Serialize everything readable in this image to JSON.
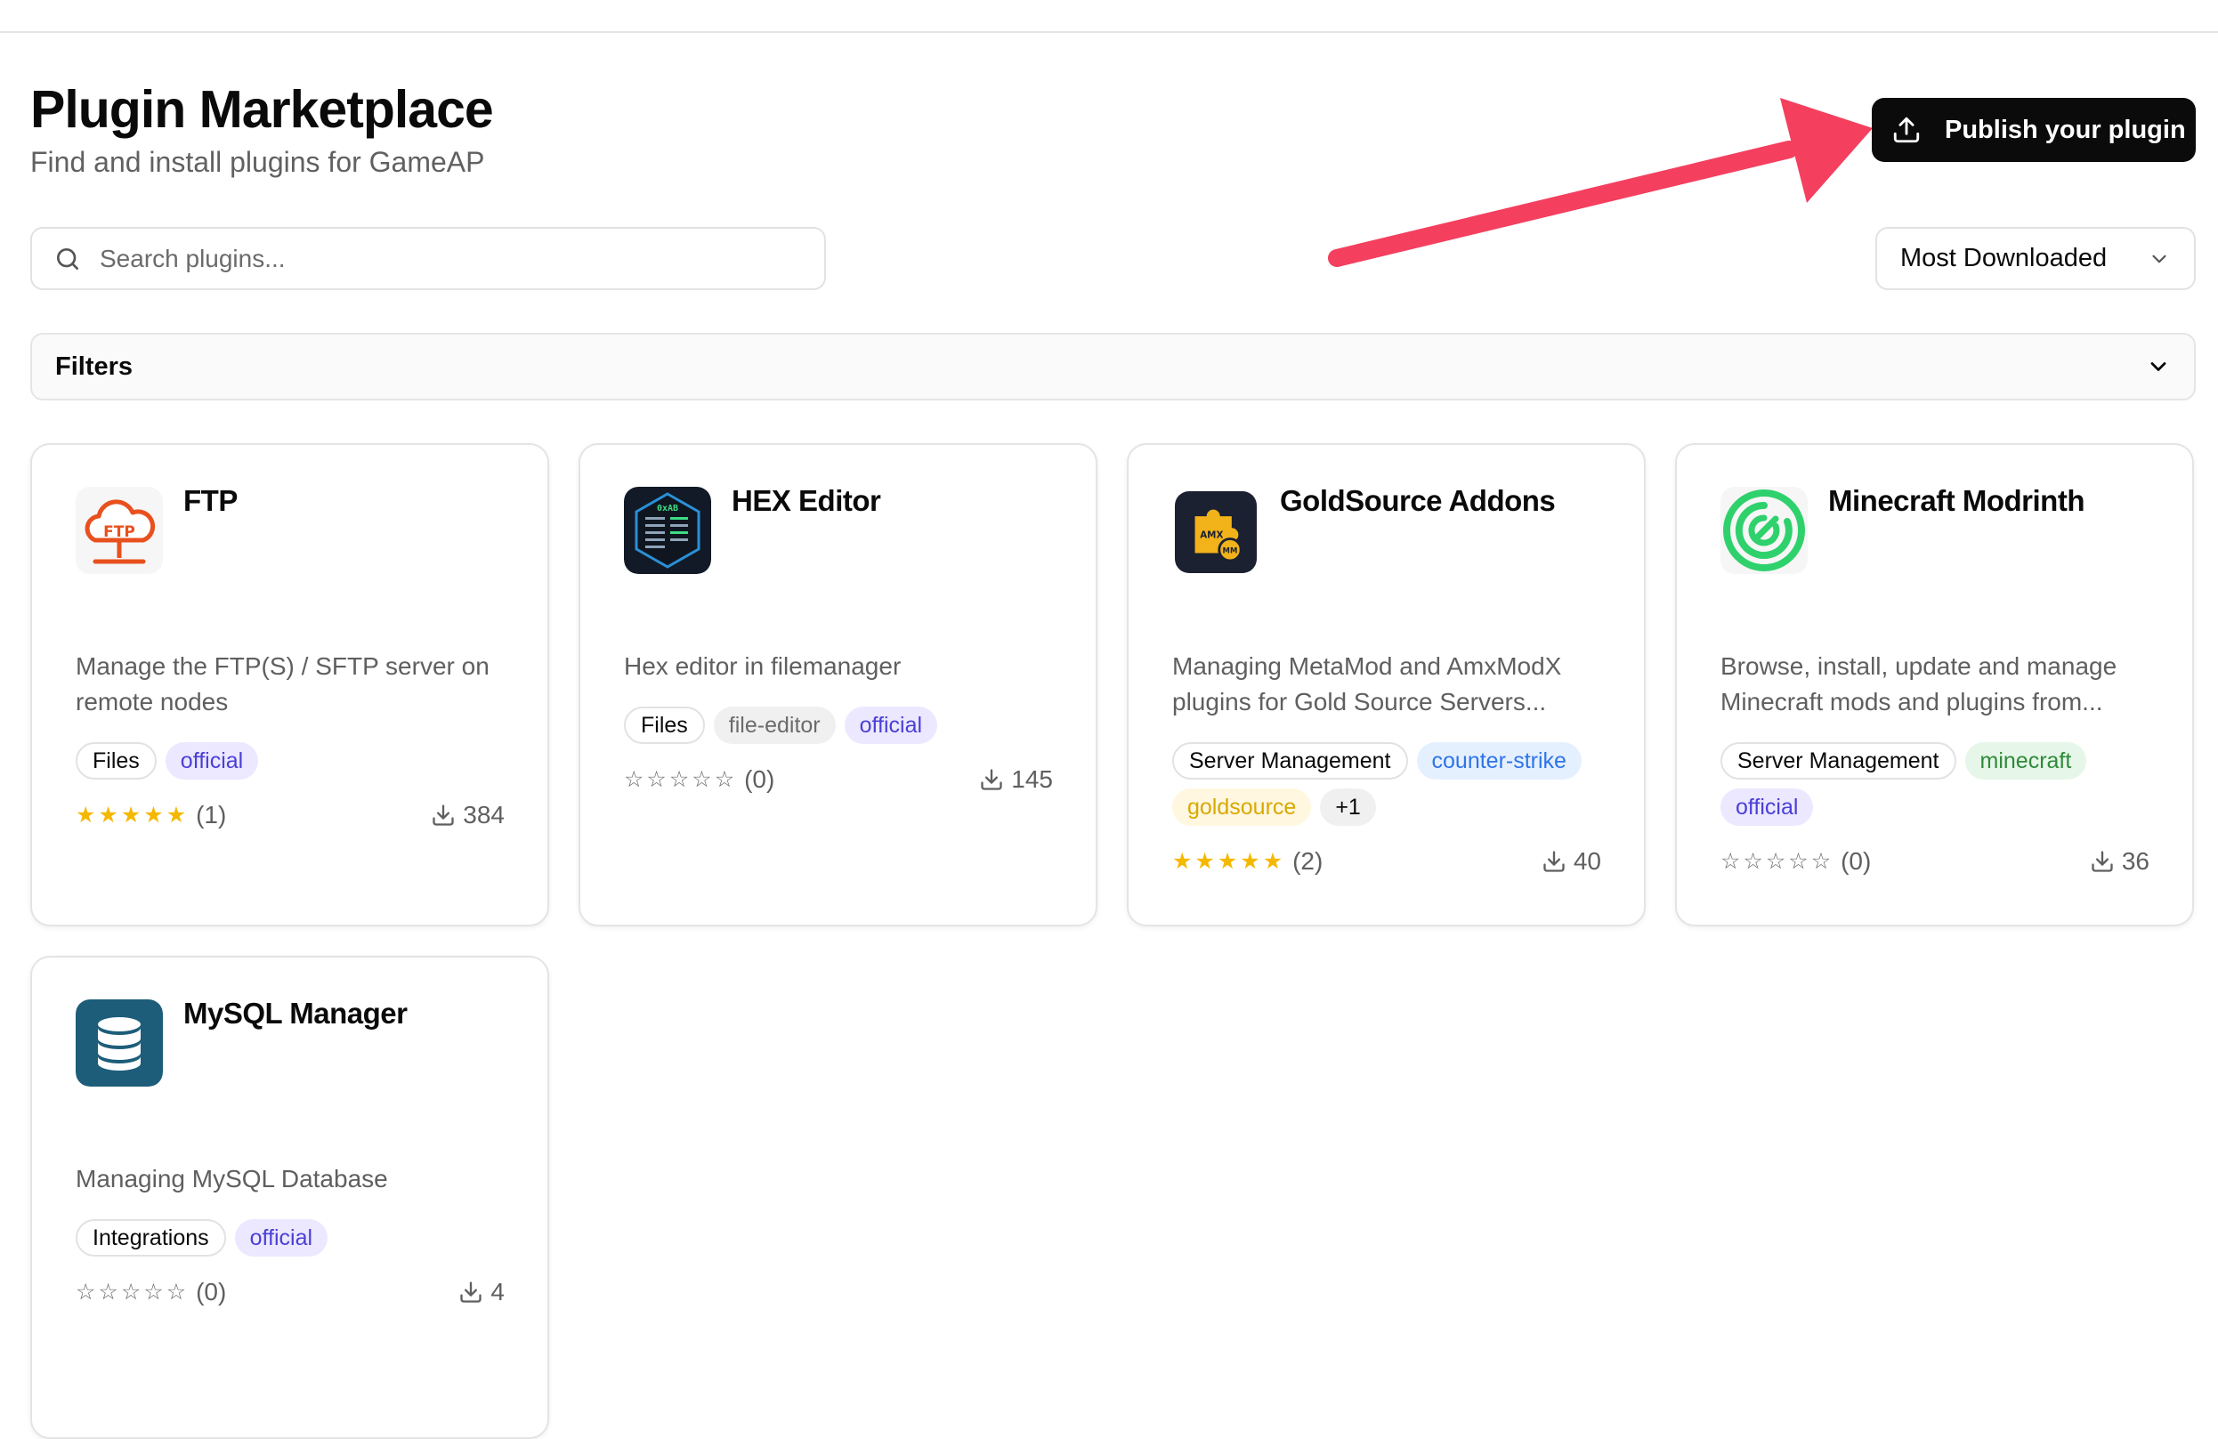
{
  "header": {
    "title": "Plugin Marketplace",
    "subtitle": "Find and install plugins for GameAP",
    "publish_label": "Publish your plugin"
  },
  "search": {
    "placeholder": "Search plugins...",
    "value": ""
  },
  "sort": {
    "selected": "Most Downloaded"
  },
  "filters": {
    "label": "Filters"
  },
  "colors": {
    "star": "#f5b800",
    "annotation_arrow": "#f43f5e",
    "primary_button": "#0b0b0b"
  },
  "plugins": [
    {
      "name": "FTP",
      "description": "Manage the FTP(S) / SFTP server on remote nodes",
      "icon": "ftp-cloud-icon",
      "tags": [
        "Files",
        "official"
      ],
      "rating": "(1)",
      "stars": 5,
      "downloads": "384"
    },
    {
      "name": "HEX Editor",
      "description": "Hex editor in filemanager",
      "icon": "hex-editor-icon",
      "tags": [
        "Files",
        "file-editor",
        "official"
      ],
      "rating": "(0)",
      "stars": 0,
      "downloads": "145",
      "logo_text": "0xAB"
    },
    {
      "name": "GoldSource Addons",
      "description": "Managing MetaMod and AmxModX plugins for Gold Source Servers...",
      "icon": "puzzle-gear-icon",
      "tags": [
        "Server Management",
        "counter-strike",
        "goldsource",
        "+1"
      ],
      "rating": "(2)",
      "stars": 5,
      "downloads": "40",
      "logo_text": "AMX",
      "logo_badge": "MM"
    },
    {
      "name": "Minecraft Modrinth",
      "description": "Browse, install, update and manage Minecraft mods and plugins from...",
      "icon": "modrinth-icon",
      "tags": [
        "Server Management",
        "minecraft",
        "official"
      ],
      "rating": "(0)",
      "stars": 0,
      "downloads": "36"
    },
    {
      "name": "MySQL Manager",
      "description": "Managing MySQL Database",
      "icon": "database-icon",
      "tags": [
        "Integrations",
        "official"
      ],
      "rating": "(0)",
      "stars": 0,
      "downloads": "4"
    }
  ]
}
